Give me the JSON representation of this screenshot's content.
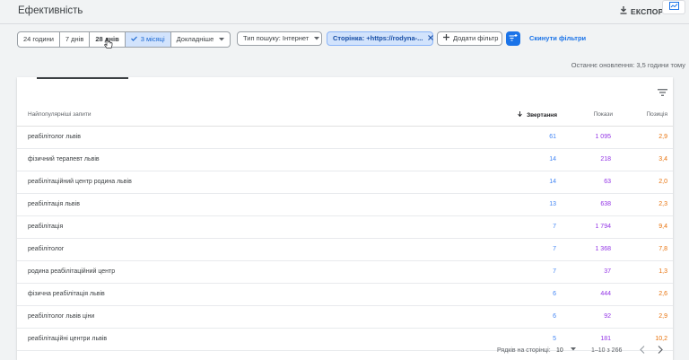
{
  "header": {
    "title": "Ефективність",
    "export_label": "ЕКСПОРТ"
  },
  "filters": {
    "date_ranges": [
      "24 години",
      "7 днів",
      "28 днів",
      "3 місяці",
      "Докладніше"
    ],
    "search_type": "Тип пошуку: Інтернет",
    "page_filter": "Сторінка: +https://rodyna-...",
    "add_filter": "Додати фільтр",
    "reset": "Скинути фільтри"
  },
  "last_updated": "Останнє оновлення: 3,5 години тому",
  "table": {
    "headers": {
      "query": "Найпопулярніші запити",
      "clicks": "Звертання",
      "impressions": "Покази",
      "position": "Позиція"
    },
    "rows": [
      {
        "query": "реабілітолог львів",
        "clicks": "61",
        "impressions": "1 095",
        "position": "2,9"
      },
      {
        "query": "фізичний терапевт львів",
        "clicks": "14",
        "impressions": "218",
        "position": "3,4"
      },
      {
        "query": "реабілітаційний центр родина львів",
        "clicks": "14",
        "impressions": "63",
        "position": "2,0"
      },
      {
        "query": "реабілітація львів",
        "clicks": "13",
        "impressions": "638",
        "position": "2,3"
      },
      {
        "query": "реабілітація",
        "clicks": "7",
        "impressions": "1 794",
        "position": "9,4"
      },
      {
        "query": "реабілітолог",
        "clicks": "7",
        "impressions": "1 368",
        "position": "7,8"
      },
      {
        "query": "родина реабілітаційний центр",
        "clicks": "7",
        "impressions": "37",
        "position": "1,3"
      },
      {
        "query": "фізична реабілітація львів",
        "clicks": "6",
        "impressions": "444",
        "position": "2,6"
      },
      {
        "query": "реабілітолог львів ціни",
        "clicks": "6",
        "impressions": "92",
        "position": "2,9"
      },
      {
        "query": "реабілітаційні центри львів",
        "clicks": "5",
        "impressions": "181",
        "position": "10,2"
      }
    ]
  },
  "pagination": {
    "rows_per_page_label": "Рядків на сторінці:",
    "rows_per_page": "10",
    "range": "1–10 з 266"
  },
  "colors": {
    "clicks": "#4285f4",
    "impressions": "#9334e6",
    "position": "#e8710a",
    "accent": "#1a73e8"
  }
}
